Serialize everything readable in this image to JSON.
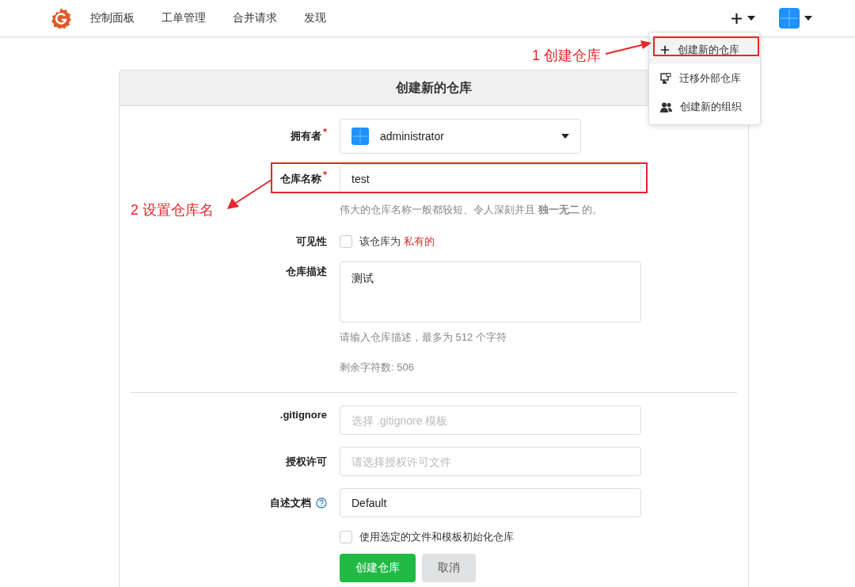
{
  "navbar": {
    "items": [
      {
        "label": "控制面板"
      },
      {
        "label": "工单管理"
      },
      {
        "label": "合并请求"
      },
      {
        "label": "发现"
      }
    ]
  },
  "menu": {
    "items": [
      {
        "kind": "plus",
        "label": "创建新的仓库",
        "selected": true
      },
      {
        "kind": "migrate",
        "label": "迁移外部仓库",
        "selected": false
      },
      {
        "kind": "org",
        "label": "创建新的组织",
        "selected": false
      }
    ]
  },
  "annotations": [
    {
      "label": "1 创建仓库"
    },
    {
      "label": "2 设置仓库名"
    }
  ],
  "form": {
    "title": "创建新的仓库",
    "owner": {
      "label": "拥有者",
      "mark": "*",
      "value": "administrator"
    },
    "name": {
      "label": "仓库名称",
      "mark": "*",
      "value": "test",
      "hint": "伟大的仓库名称一般都较短、令人深刻并且 **独一无二** 的。"
    },
    "visibility": {
      "label": "可见性",
      "checked": false,
      "text": "该仓库为",
      "highlight": "私有的"
    },
    "description": {
      "label": "仓库描述",
      "value": "测试",
      "hint": "请输入仓库描述，最多为 512 个字符",
      "remaining": "剩余字符数: 506"
    },
    "gitignore": {
      "label": ".gitignore",
      "placeholder": "选择 .gitignore 模板"
    },
    "license": {
      "label": "授权许可",
      "placeholder": "请选择授权许可文件"
    },
    "readme": {
      "label": "自述文档",
      "value": "Default"
    },
    "init": {
      "label": "使用选定的文件和模板初始化仓库",
      "checked": false
    },
    "buttons": [
      {
        "label": "创建仓库",
        "kind": "primary"
      },
      {
        "label": "取消",
        "kind": "secondary"
      }
    ]
  }
}
